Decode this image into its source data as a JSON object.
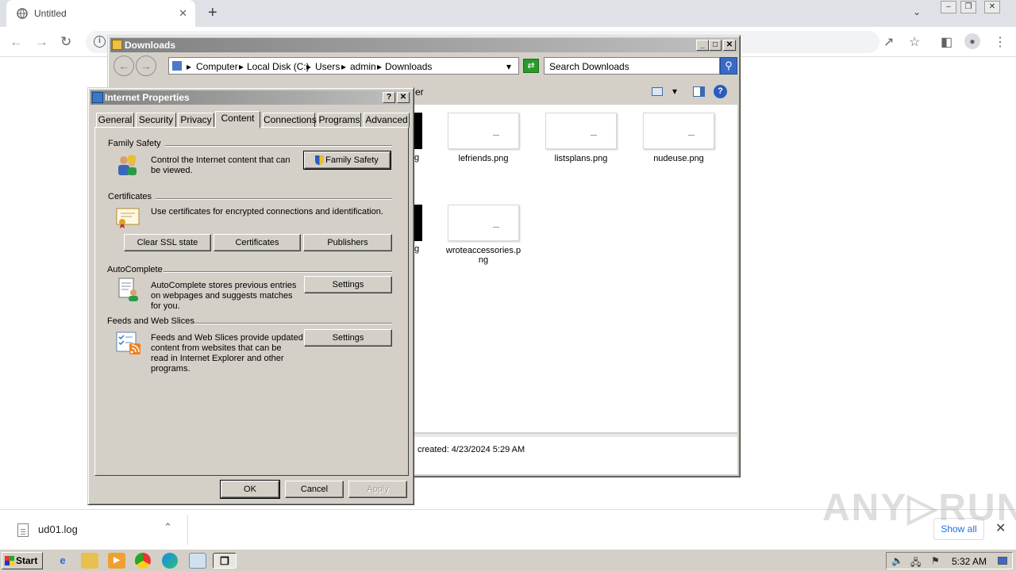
{
  "browser": {
    "tab_title": "Untitled",
    "tab_close": "✕",
    "new_tab": "+",
    "back": "←",
    "forward": "→",
    "reload": "↻"
  },
  "explorer": {
    "title": "Downloads",
    "breadcrumb": [
      "Computer",
      "Local Disk (C:)",
      "Users",
      "admin",
      "Downloads"
    ],
    "search_placeholder": "Search Downloads",
    "cmd_tail": "er",
    "files": [
      {
        "name": "lefriends.png"
      },
      {
        "name": "listsplans.png"
      },
      {
        "name": "nudeuse.png"
      },
      {
        "name": "wroteaccessories.png"
      }
    ],
    "partial_labels": [
      "g",
      "g"
    ],
    "details": "created: 4/23/2024 5:29 AM"
  },
  "dialog": {
    "title": "Internet Properties",
    "help": "?",
    "close": "✕",
    "tabs": [
      "General",
      "Security",
      "Privacy",
      "Content",
      "Connections",
      "Programs",
      "Advanced"
    ],
    "selected_tab": "Content",
    "family_safety": {
      "heading": "Family Safety",
      "text_line1": "Control the Internet content that can",
      "text_line2": "be viewed.",
      "button": "Family Safety"
    },
    "certificates": {
      "heading": "Certificates",
      "text": "Use certificates for encrypted connections and identification.",
      "buttons": [
        "Clear SSL state",
        "Certificates",
        "Publishers"
      ]
    },
    "autocomplete": {
      "heading": "AutoComplete",
      "text_lines": [
        "AutoComplete stores previous entries",
        "on webpages and suggests matches",
        "for you."
      ],
      "button": "Settings"
    },
    "feeds": {
      "heading": "Feeds and Web Slices",
      "text_lines": [
        "Feeds and Web Slices provide updated",
        "content from websites that can be",
        "read in Internet Explorer and other",
        "programs."
      ],
      "button": "Settings"
    },
    "footer": {
      "ok": "OK",
      "cancel": "Cancel",
      "apply": "Apply"
    }
  },
  "download_bar": {
    "file": "ud01.log",
    "show_all": "Show all",
    "close": "✕"
  },
  "taskbar": {
    "start": "Start",
    "clock": "5:32 AM"
  },
  "watermark": "ANY▷RUN"
}
